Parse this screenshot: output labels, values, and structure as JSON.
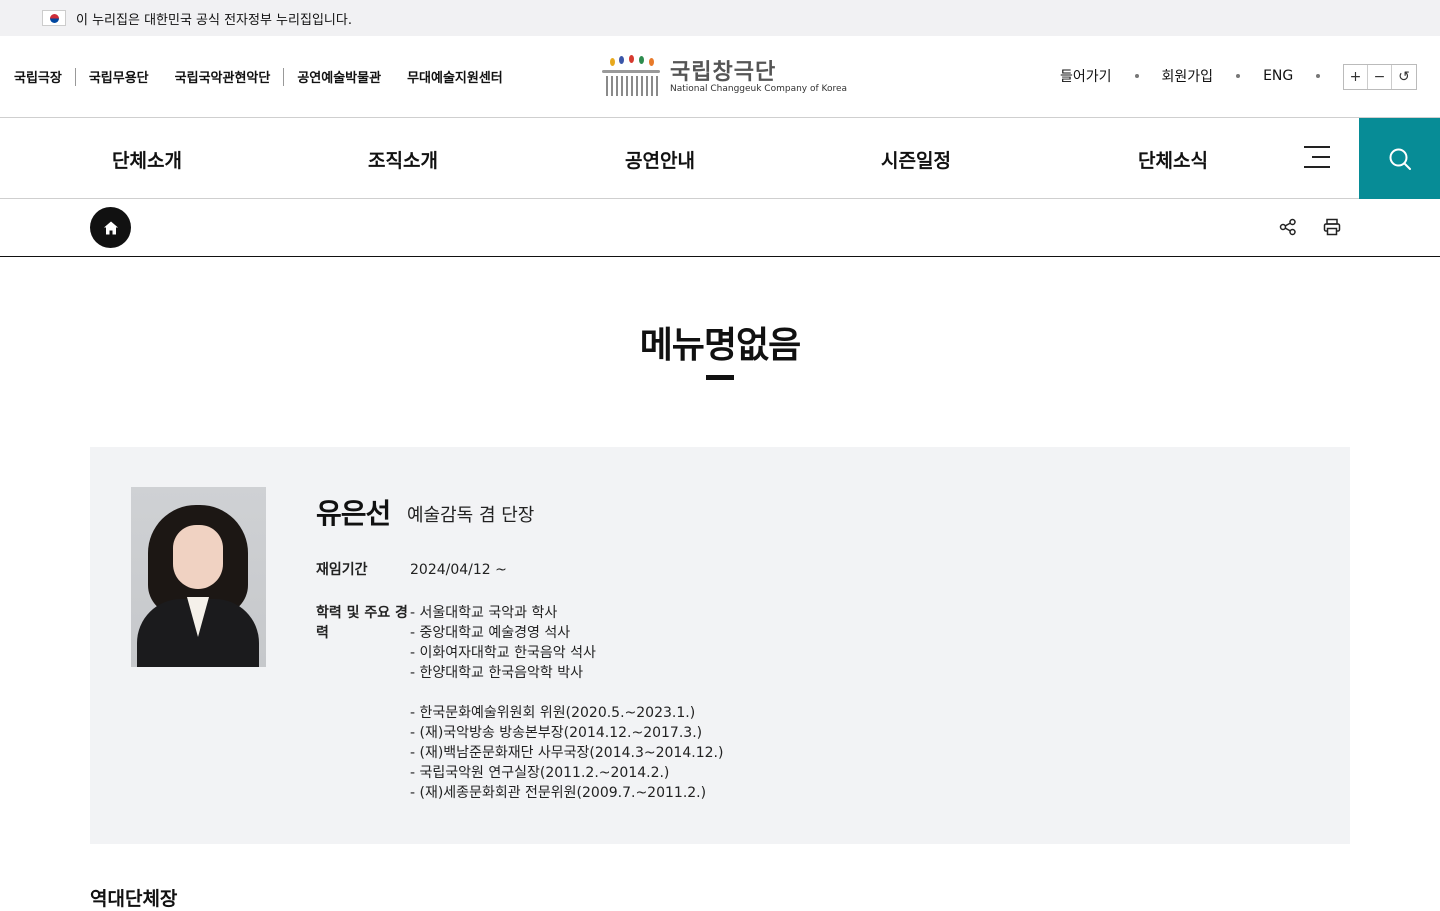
{
  "gov_banner": {
    "text": "이 누리집은 대한민국 공식 전자정부 누리집입니다."
  },
  "family_links": [
    "국립극장",
    "국립무용단",
    "국립국악관현악단",
    "공연예술박물관",
    "무대예술지원센터"
  ],
  "logo": {
    "ko": "국립창극단",
    "en": "National Changgeuk Company of Korea"
  },
  "util": {
    "login": "들어가기",
    "join": "회원가입",
    "lang": "ENG"
  },
  "zoom": {
    "plus": "+",
    "minus": "−",
    "reset": "↺"
  },
  "gnb": [
    "단체소개",
    "조직소개",
    "공연안내",
    "시즌일정",
    "단체소식"
  ],
  "page": {
    "title": "메뉴명없음"
  },
  "profile": {
    "name": "유은선",
    "role": "예술감독 겸 단장",
    "term_label": "재임기간",
    "term_value": "2024/04/12 ~",
    "career_label": "학력 및 주요 경력",
    "career": [
      "- 서울대학교 국악과 학사",
      "- 중앙대학교 예술경영 석사",
      "- 이화여자대학교 한국음악 석사",
      "- 한양대학교 한국음악학 박사",
      "",
      "- 한국문화예술위원회 위원(2020.5.~2023.1.)",
      "- (재)국악방송 방송본부장(2014.12.~2017.3.)",
      "- (재)백남준문화재단 사무국장(2014.3~2014.12.)",
      "- 국립국악원 연구실장(2011.2.~2014.2.)",
      "- (재)세종문화회관 전문위원(2009.7.~2011.2.)"
    ]
  },
  "section": {
    "title": "역대단체장"
  },
  "colors": {
    "accent": "#078c96",
    "panel": "#f2f3f5"
  },
  "icons": [
    "korea-flag-icon",
    "menu-icon",
    "search-icon",
    "home-icon",
    "share-icon",
    "print-icon"
  ]
}
